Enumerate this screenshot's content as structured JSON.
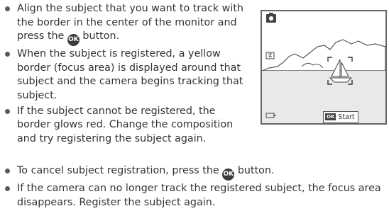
{
  "ok_symbol": "OK",
  "top_items": [
    {
      "pre": "Align the subject that you want to track with the border in the center of the monitor and press the ",
      "post": " button."
    },
    {
      "text": "When the subject is registered, a yellow border (focus area) is displayed around that subject and the camera begins tracking that subject."
    },
    {
      "text": "If the subject cannot be registered, the border glows red. Change the composition and try registering the subject again."
    }
  ],
  "bottom_items": [
    {
      "pre": "To cancel subject registration, press the ",
      "post": " button."
    },
    {
      "text": "If the camera can no longer track the registered subject, the focus area disappears. Register the subject again."
    }
  ],
  "camera_screen": {
    "start_label": "Start",
    "icons": [
      "camera-mode-icon",
      "flash-mode-icon",
      "battery-icon",
      "ok-button-icon",
      "tracking-border-icon"
    ]
  }
}
